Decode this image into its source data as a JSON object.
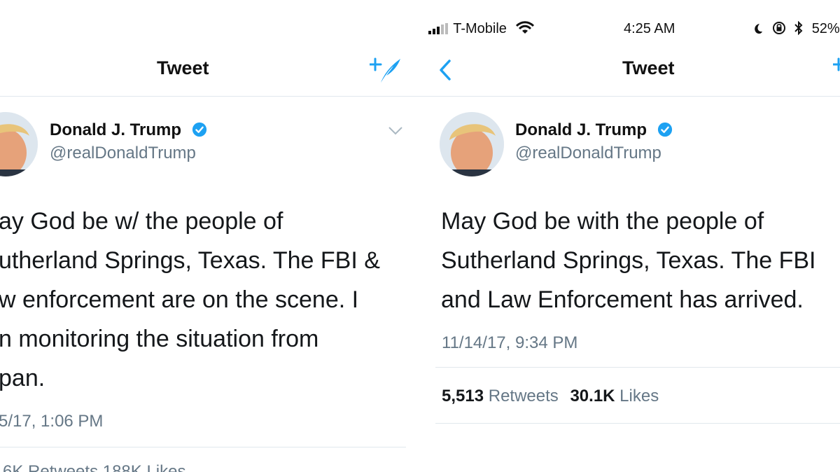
{
  "left": {
    "header": {
      "title": "Tweet"
    },
    "user": {
      "name": "Donald J. Trump",
      "handle": "@realDonaldTrump"
    },
    "tweet_lines": [
      "ay God be w/ the people of",
      "utherland Springs, Texas. The FBI &",
      "w enforcement are on the scene. I",
      "n monitoring the situation from",
      "pan."
    ],
    "timestamp": "5/17, 1:06 PM",
    "stats_partial": "6K Retweets 188K Likes"
  },
  "right": {
    "status_bar": {
      "carrier": "T-Mobile",
      "time": "4:25 AM",
      "battery": "52%"
    },
    "header": {
      "title": "Tweet"
    },
    "user": {
      "name": "Donald J. Trump",
      "handle": "@realDonaldTrump"
    },
    "tweet_lines": [
      "May God be with the people of",
      "Sutherland Springs, Texas. The FBI",
      "and Law Enforcement has arrived."
    ],
    "timestamp": "11/14/17, 9:34 PM",
    "stats": {
      "retweets_count": "5,513",
      "retweets_label": "Retweets",
      "likes_count": "30.1K",
      "likes_label": "Likes"
    }
  },
  "colors": {
    "accent": "#1da1f2",
    "secondary_text": "#657786",
    "divider": "#e1e8ed"
  },
  "icons": [
    "compose-tweet-icon",
    "chevron-down-icon",
    "back-icon",
    "verified-badge-icon",
    "signal-icon",
    "wifi-icon",
    "moon-icon",
    "orientation-lock-icon",
    "bluetooth-icon"
  ]
}
